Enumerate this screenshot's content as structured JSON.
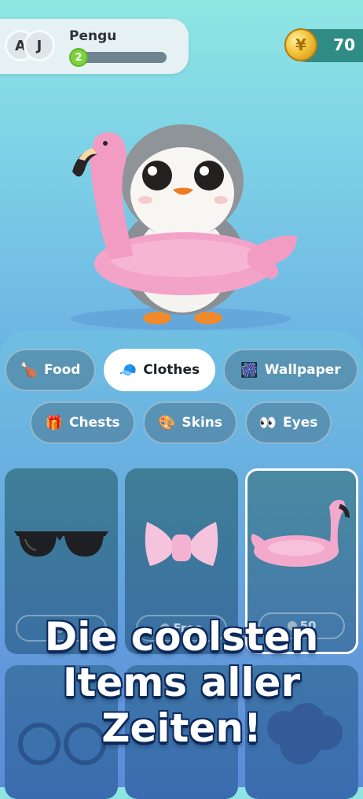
{
  "header": {
    "avatars": [
      "A",
      "J"
    ],
    "username": "Pengu",
    "level": "2",
    "xp_progress": 0.05,
    "coins": "70",
    "coin_symbol": "¥"
  },
  "pet": {
    "name": "penguin-with-flamingo-float"
  },
  "tabs": [
    {
      "label": "Food",
      "icon": "🍗"
    },
    {
      "label": "Clothes",
      "icon": "🧢",
      "active": true
    },
    {
      "label": "Wallpaper",
      "icon": "🎆"
    },
    {
      "label": "Chests",
      "icon": "🎁"
    },
    {
      "label": "Skins",
      "icon": "🎨"
    },
    {
      "label": "Eyes",
      "icon": "👀"
    }
  ],
  "items": [
    {
      "name": "sunglasses",
      "price": ""
    },
    {
      "name": "pink-bow",
      "price": "Free"
    },
    {
      "name": "flamingo-float",
      "price": "50",
      "selected": true
    }
  ],
  "promo": {
    "line1": "Die coolsten",
    "line2": "Items aller",
    "line3": "Zeiten!"
  }
}
